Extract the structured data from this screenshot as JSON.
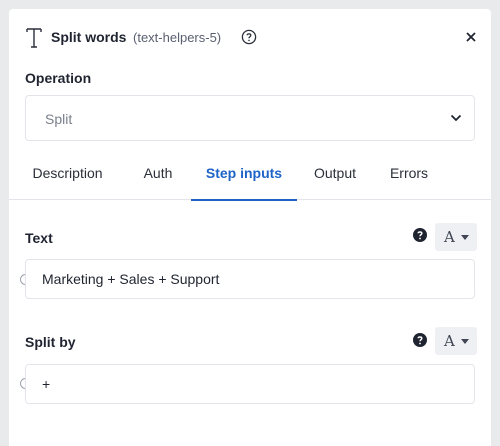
{
  "header": {
    "title": "Split words",
    "subtitle": "(text-helpers-5)",
    "icons": {
      "title": "text-type-icon",
      "help": "help-circle-icon",
      "close": "close-icon"
    }
  },
  "operation": {
    "label": "Operation",
    "selected": "Split"
  },
  "tabs": [
    {
      "label": "Description",
      "active": false
    },
    {
      "label": "Auth",
      "active": false
    },
    {
      "label": "Step inputs",
      "active": true
    },
    {
      "label": "Output",
      "active": false
    },
    {
      "label": "Errors",
      "active": false
    }
  ],
  "fields": [
    {
      "label": "Text",
      "type_letter": "A",
      "value": "Marketing + Sales + Support"
    },
    {
      "label": "Split by",
      "type_letter": "A",
      "value": "+"
    }
  ],
  "colors": {
    "accent": "#1e64c8",
    "background": "#e9eaec",
    "panel": "#ffffff",
    "border": "#e3e5ea"
  }
}
